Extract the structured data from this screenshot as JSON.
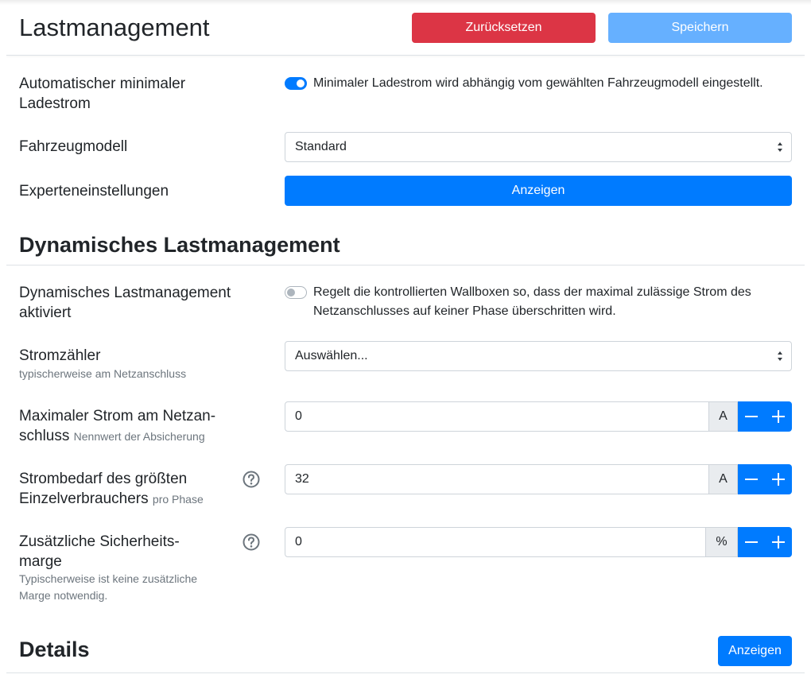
{
  "header": {
    "title": "Lastmanagement",
    "reset_label": "Zurücksetzen",
    "save_label": "Speichern"
  },
  "auto_min_current": {
    "label_line1": "Automatischer minimaler",
    "label_line2": "Ladestrom",
    "enabled": true,
    "description": "Minimaler Ladestrom wird abhängig vom gewählten Fahrzeugmodell eingestellt."
  },
  "vehicle_model": {
    "label": "Fahrzeugmodell",
    "selected": "Standard"
  },
  "expert": {
    "label": "Experteneinstellungen",
    "button_label": "Anzeigen"
  },
  "dynamic": {
    "section_title": "Dynamisches Lastmanagement",
    "enable": {
      "label_line1": "Dynamisches Lastmanagement",
      "label_line2": "aktiviert",
      "enabled": false,
      "description_line1": "Regelt die kontrollierten Wallboxen so, dass der maximal zulässige Strom des",
      "description_line2": "Netzanschlusses auf keiner Phase überschritten wird."
    },
    "meter": {
      "label": "Stromzähler",
      "sublabel": "typischerweise am Netzanschluss",
      "selected": "Auswählen..."
    },
    "max_current": {
      "label_line1": "Maximaler Strom am Netzan-",
      "label_line2": "schluss",
      "hint": "Nennwert der Absicherung",
      "value": "0",
      "unit": "A"
    },
    "largest_consumer": {
      "label_line1": "Strombedarf des größten",
      "label_line2": "Einzelverbrauchers",
      "hint": "pro Phase",
      "value": "32",
      "unit": "A"
    },
    "safety_margin": {
      "label_line1": "Zusätzliche Sicherheits-",
      "label_line2": "marge",
      "sub_line1": "Typischerweise ist keine zusätzliche",
      "sub_line2": "Marge notwendig.",
      "value": "0",
      "unit": "%"
    }
  },
  "details": {
    "section_title": "Details",
    "button_label": "Anzeigen"
  },
  "colors": {
    "primary": "#007bff",
    "danger": "#dc3545",
    "save_disabled": "#66b0ff"
  },
  "icons": {
    "help": "help-circle-icon",
    "minus": "minus-icon",
    "plus": "plus-icon",
    "select_arrows": "select-arrows-icon"
  }
}
